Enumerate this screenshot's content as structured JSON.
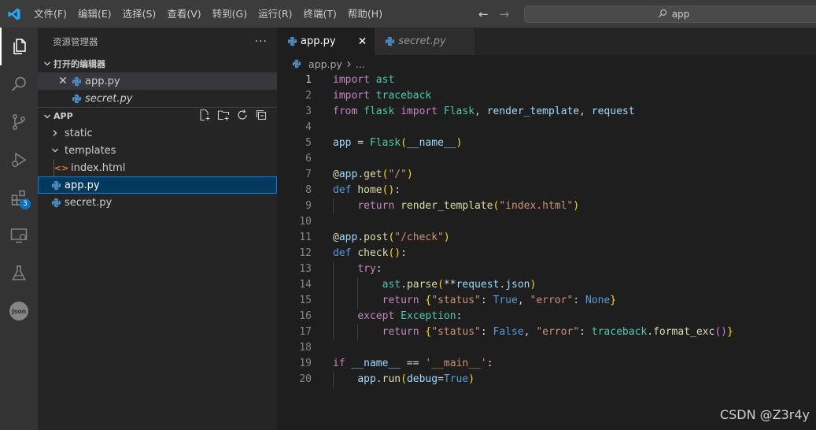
{
  "menu": [
    "文件(F)",
    "编辑(E)",
    "选择(S)",
    "查看(V)",
    "转到(G)",
    "运行(R)",
    "终端(T)",
    "帮助(H)"
  ],
  "search": {
    "text": "app"
  },
  "activity_bar": {
    "icons": [
      "explorer-icon",
      "search-icon",
      "source-control-icon",
      "run-debug-icon",
      "extensions-icon",
      "remote-explorer-icon",
      "testing-icon",
      "json-icon"
    ],
    "extensions_badge": "3",
    "json_label": "Json"
  },
  "sidebar": {
    "title": "资源管理器",
    "open_editors": {
      "label": "打开的编辑器",
      "items": [
        {
          "name": "app.py"
        },
        {
          "name": "secret.py"
        }
      ]
    },
    "folder": {
      "label": "APP",
      "items": [
        {
          "name": "static",
          "type": "folder"
        },
        {
          "name": "templates",
          "type": "folder"
        },
        {
          "name": "index.html",
          "type": "html"
        },
        {
          "name": "app.py",
          "type": "python"
        },
        {
          "name": "secret.py",
          "type": "python"
        }
      ]
    }
  },
  "editor": {
    "tabs": [
      {
        "label": "app.py",
        "active": true
      },
      {
        "label": "secret.py",
        "active": false
      }
    ],
    "breadcrumb": {
      "file": "app.py",
      "rest": "..."
    },
    "line_numbers": [
      "1",
      "2",
      "3",
      "4",
      "5",
      "6",
      "7",
      "8",
      "9",
      "10",
      "11",
      "12",
      "13",
      "14",
      "15",
      "16",
      "17",
      "18",
      "19",
      "20"
    ],
    "code": [
      "import ast",
      "import traceback",
      "from flask import Flask, render_template, request",
      "",
      "app = Flask(__name__)",
      "",
      "@app.get(\"/\")",
      "def home():",
      "    return render_template(\"index.html\")",
      "",
      "@app.post(\"/check\")",
      "def check():",
      "    try:",
      "        ast.parse(**request.json)",
      "        return {\"status\": True, \"error\": None}",
      "    except Exception:",
      "        return {\"status\": False, \"error\": traceback.format_exc()}",
      "",
      "if __name__ == '__main__':",
      "    app.run(debug=True)"
    ]
  },
  "watermark": "CSDN @Z3r4y"
}
